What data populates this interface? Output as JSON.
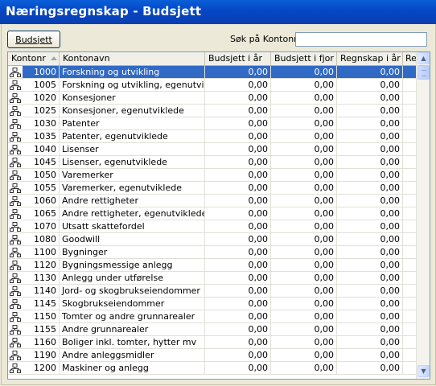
{
  "window": {
    "title": "Næringsregnskap - Budsjett"
  },
  "toolbar": {
    "budget_button": "Budsjett",
    "search_label": "Søk på Kontonr:",
    "search_value": ""
  },
  "table": {
    "columns": [
      "Kontonr",
      "Kontonavn",
      "Budsjett i år",
      "Budsjett i fjor",
      "Regnskap i år",
      "Re"
    ],
    "sort_column": "Kontonr",
    "rows": [
      {
        "nr": "1000",
        "navn": "Forskning og utvikling",
        "b": "0,00",
        "bf": "0,00",
        "r": "0,00",
        "selected": true
      },
      {
        "nr": "1005",
        "navn": "Forskning og utvikling, egenutviklet",
        "b": "0,00",
        "bf": "0,00",
        "r": "0,00"
      },
      {
        "nr": "1020",
        "navn": "Konsesjoner",
        "b": "0,00",
        "bf": "0,00",
        "r": "0,00"
      },
      {
        "nr": "1025",
        "navn": "Konsesjoner, egenutviklede",
        "b": "0,00",
        "bf": "0,00",
        "r": "0,00"
      },
      {
        "nr": "1030",
        "navn": "Patenter",
        "b": "0,00",
        "bf": "0,00",
        "r": "0,00"
      },
      {
        "nr": "1035",
        "navn": "Patenter, egenutviklede",
        "b": "0,00",
        "bf": "0,00",
        "r": "0,00"
      },
      {
        "nr": "1040",
        "navn": "Lisenser",
        "b": "0,00",
        "bf": "0,00",
        "r": "0,00"
      },
      {
        "nr": "1045",
        "navn": "Lisenser, egenutviklede",
        "b": "0,00",
        "bf": "0,00",
        "r": "0,00"
      },
      {
        "nr": "1050",
        "navn": "Varemerker",
        "b": "0,00",
        "bf": "0,00",
        "r": "0,00"
      },
      {
        "nr": "1055",
        "navn": "Varemerker, egenutviklede",
        "b": "0,00",
        "bf": "0,00",
        "r": "0,00"
      },
      {
        "nr": "1060",
        "navn": "Andre rettigheter",
        "b": "0,00",
        "bf": "0,00",
        "r": "0,00"
      },
      {
        "nr": "1065",
        "navn": "Andre rettigheter, egenutviklede",
        "b": "0,00",
        "bf": "0,00",
        "r": "0,00"
      },
      {
        "nr": "1070",
        "navn": "Utsatt skattefordel",
        "b": "0,00",
        "bf": "0,00",
        "r": "0,00"
      },
      {
        "nr": "1080",
        "navn": "Goodwill",
        "b": "0,00",
        "bf": "0,00",
        "r": "0,00"
      },
      {
        "nr": "1100",
        "navn": "Bygninger",
        "b": "0,00",
        "bf": "0,00",
        "r": "0,00"
      },
      {
        "nr": "1120",
        "navn": "Bygningsmessige anlegg",
        "b": "0,00",
        "bf": "0,00",
        "r": "0,00"
      },
      {
        "nr": "1130",
        "navn": "Anlegg under utførelse",
        "b": "0,00",
        "bf": "0,00",
        "r": "0,00"
      },
      {
        "nr": "1140",
        "navn": "Jord- og skogbrukseiendommer",
        "b": "0,00",
        "bf": "0,00",
        "r": "0,00"
      },
      {
        "nr": "1145",
        "navn": "Skogbrukseiendommer",
        "b": "0,00",
        "bf": "0,00",
        "r": "0,00"
      },
      {
        "nr": "1150",
        "navn": "Tomter og andre grunnarealer",
        "b": "0,00",
        "bf": "0,00",
        "r": "0,00"
      },
      {
        "nr": "1155",
        "navn": "Andre grunnarealer",
        "b": "0,00",
        "bf": "0,00",
        "r": "0,00"
      },
      {
        "nr": "1160",
        "navn": "Boliger inkl. tomter, hytter mv",
        "b": "0,00",
        "bf": "0,00",
        "r": "0,00"
      },
      {
        "nr": "1190",
        "navn": "Andre anleggsmidler",
        "b": "0,00",
        "bf": "0,00",
        "r": "0,00"
      },
      {
        "nr": "1200",
        "navn": "Maskiner og anlegg",
        "b": "0,00",
        "bf": "0,00",
        "r": "0,00"
      }
    ]
  },
  "colors": {
    "title_bar": "#0a4fcc",
    "selection": "#316ac5",
    "window_bg": "#ece9d8"
  }
}
